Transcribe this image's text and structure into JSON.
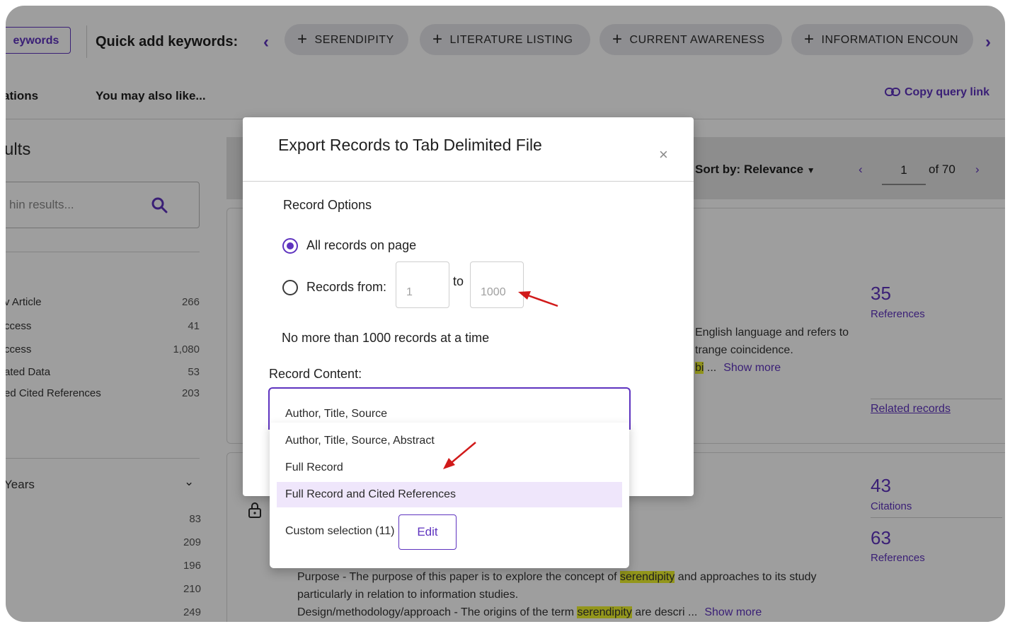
{
  "keyword_bar": {
    "keywords_button": "eywords",
    "quick_add_label": "Quick add keywords:",
    "chips": [
      "SERENDIPITY",
      "LITERATURE LISTING",
      "CURRENT AWARENESS",
      "INFORMATION ENCOUN"
    ]
  },
  "tabs": {
    "left": "ations",
    "recommend": "You may also like...",
    "copy_link": "Copy query link"
  },
  "sidebar": {
    "results_heading": "ults",
    "search_placeholder": "hin results...",
    "facets": [
      {
        "label": "v Article",
        "count": "266"
      },
      {
        "label": "ccess",
        "count": "41"
      },
      {
        "label": "ccess",
        "count": "1,080"
      },
      {
        "label": "ated Data",
        "count": "53"
      },
      {
        "label": "ed Cited References",
        "count": "203"
      }
    ],
    "years_heading": "Years",
    "year_counts": [
      "83",
      "209",
      "196",
      "210",
      "249"
    ]
  },
  "sortbar": {
    "sort_label": "Sort by: Relevance",
    "page": "1",
    "of_pages": "of 70"
  },
  "results": {
    "card1": {
      "ref_count": "35",
      "ref_label": "References",
      "snippet_line1": "English language and refers to",
      "snippet_line2": "trange coincidence.",
      "snippet_line3_frag": "bi",
      "show_more": "Show more",
      "related": "Related records"
    },
    "card2": {
      "cite_count": "43",
      "cite_label": "Citations",
      "ref_count": "63",
      "ref_label": "References",
      "purpose_pre": "Purpose - The purpose of this paper is to explore the concept of ",
      "purpose_hl": "serendipity",
      "purpose_post": " and approaches to its study",
      "line2": "particularly in relation to information studies.",
      "design_pre": "Design/methodology/approach - The origins of the term ",
      "design_hl": "serendipity",
      "design_post": " are descri ...",
      "show_more": "Show more"
    }
  },
  "modal": {
    "title": "Export Records to Tab Delimited File",
    "close": "×",
    "record_options": "Record Options",
    "all_records": "All records on page",
    "records_from": "Records from:",
    "from_value": "1",
    "to_label": "to",
    "to_value": "1000",
    "limit_note": "No more than 1000 records at a time",
    "record_content": "Record Content:",
    "selected_record_content": "Full Record and Cited References",
    "dropdown_options": [
      "Author, Title, Source",
      "Author, Title, Source, Abstract",
      "Full Record",
      "Full Record and Cited References"
    ],
    "custom_selection": "Custom selection (11)",
    "edit_button": "Edit"
  },
  "colors": {
    "accent": "#5e33bf",
    "highlight": "#eef22c",
    "annotation_arrow": "#d11a1a"
  }
}
